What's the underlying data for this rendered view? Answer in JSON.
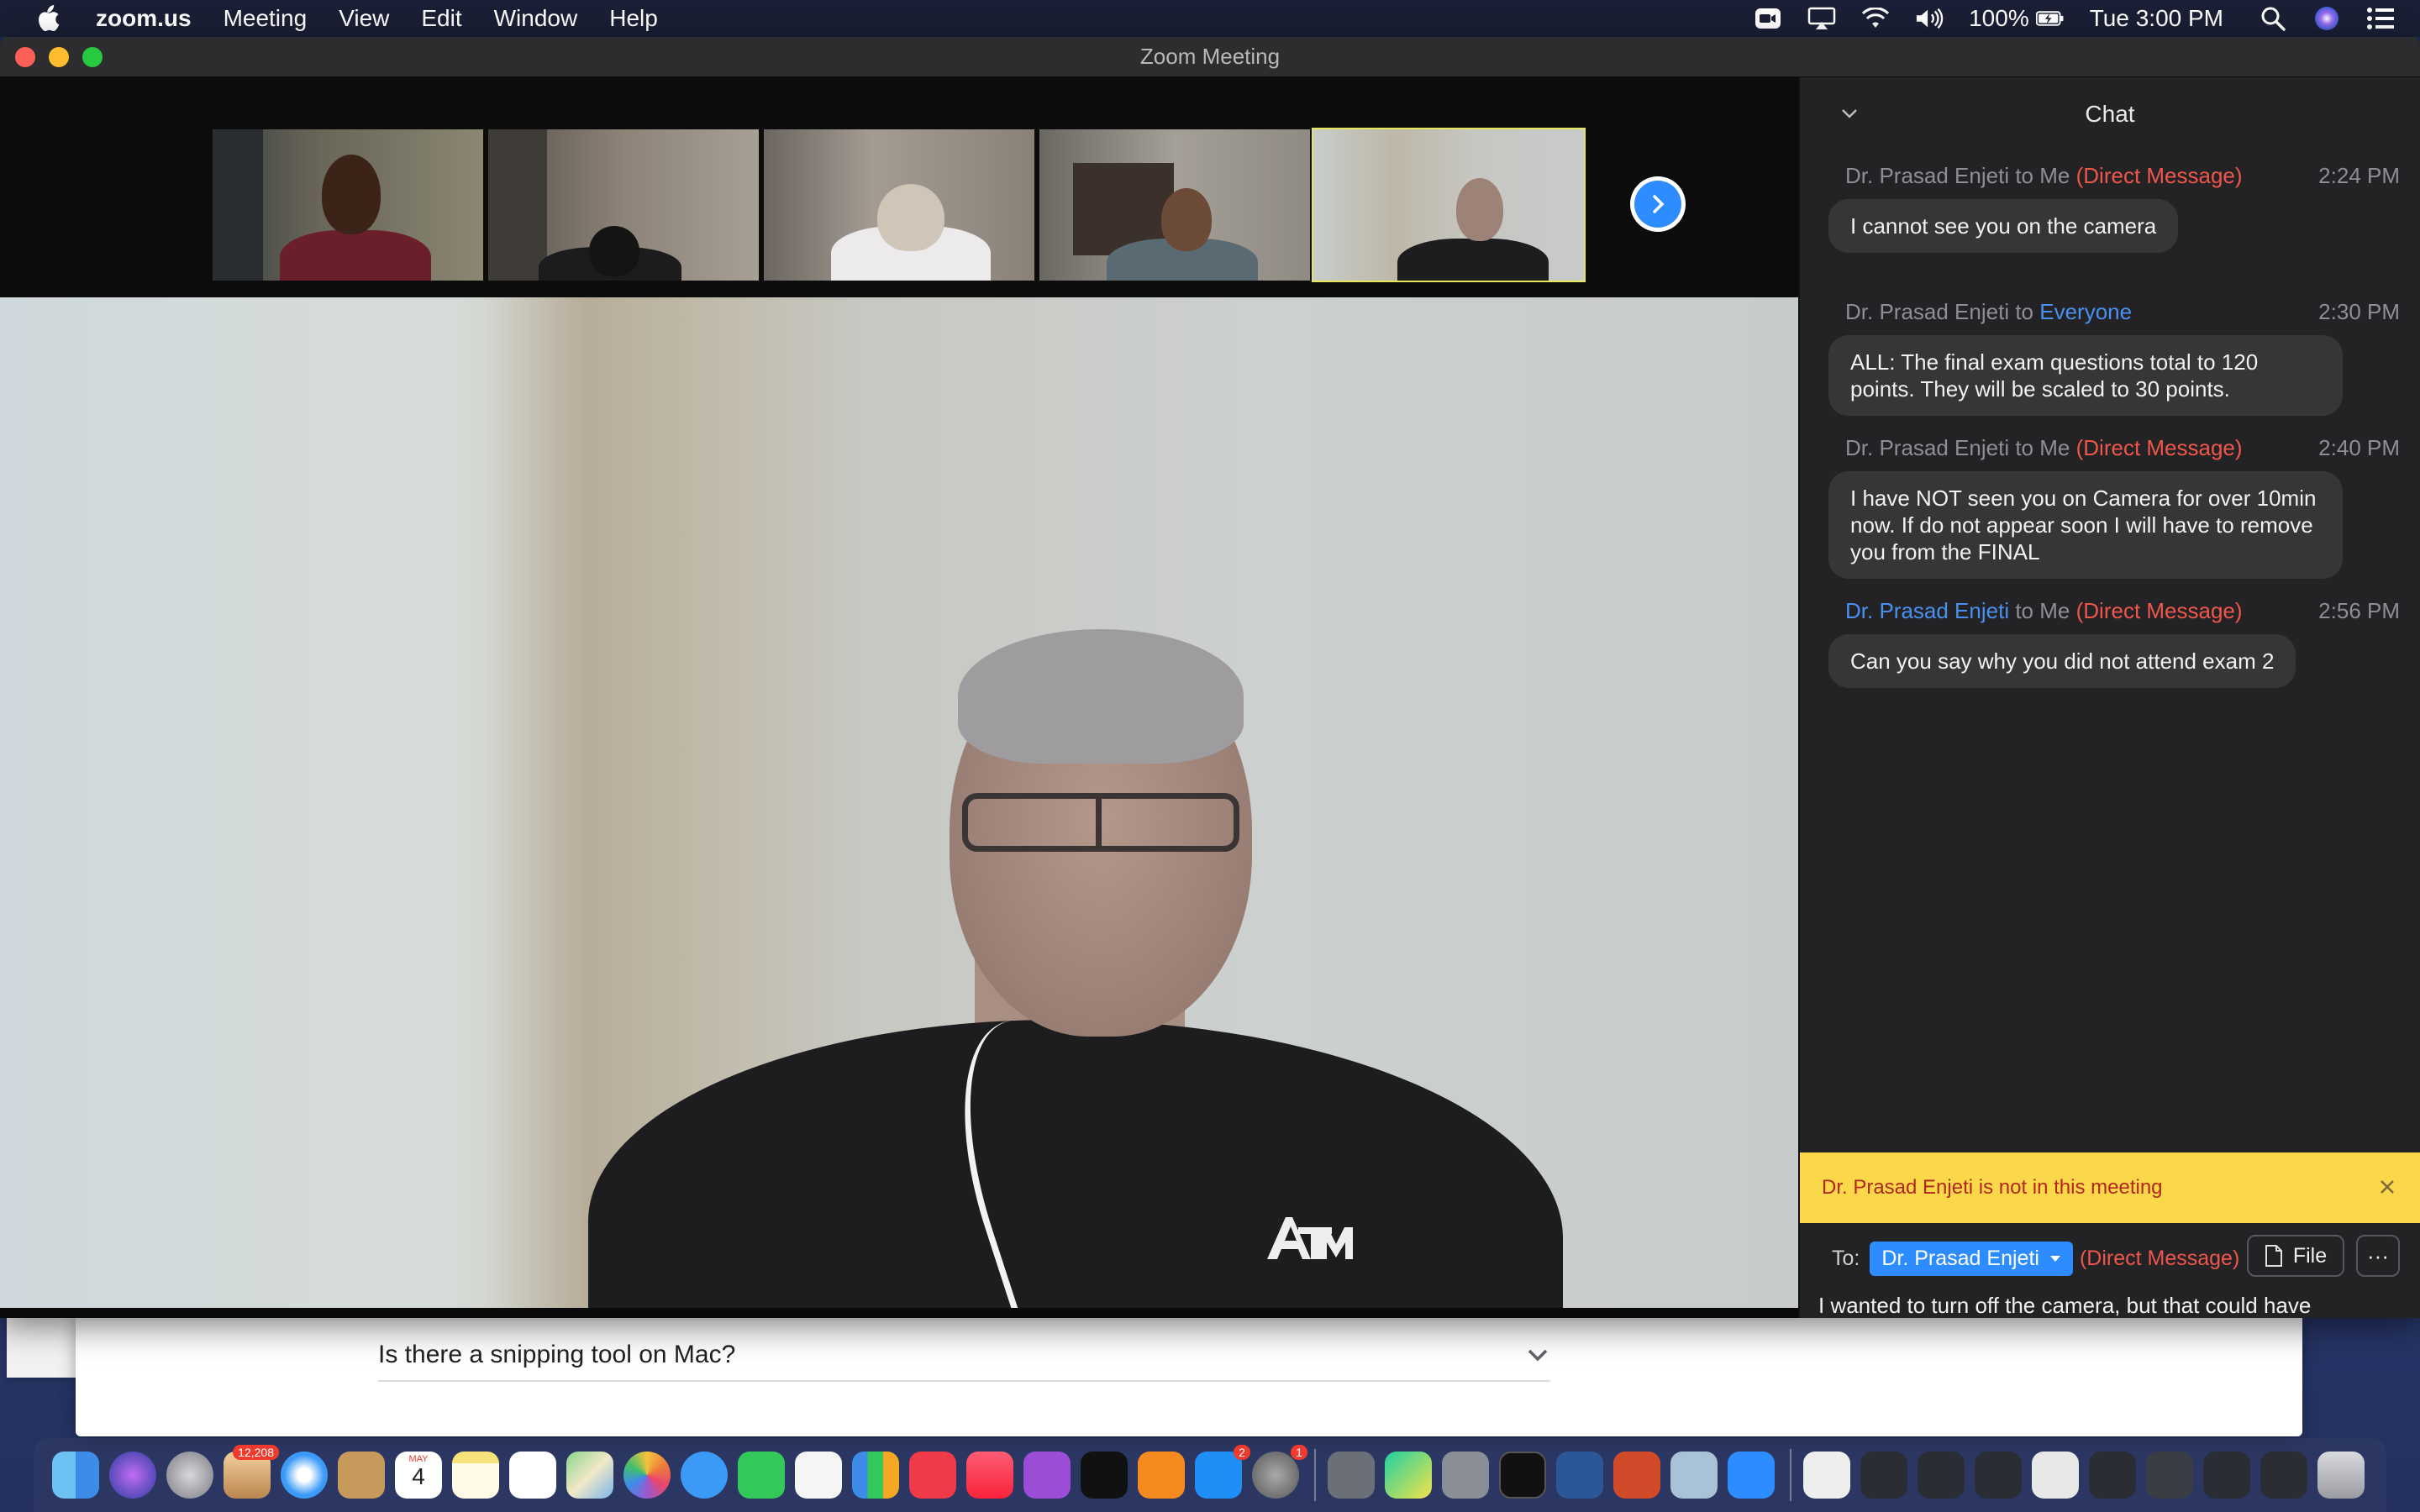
{
  "menubar": {
    "app_name": "zoom.us",
    "items": [
      "Meeting",
      "View",
      "Edit",
      "Window",
      "Help"
    ],
    "battery": "100%",
    "clock": "Tue 3:00 PM",
    "status_icons": [
      "zoom-camera-icon",
      "airplay-icon",
      "wifi-icon",
      "volume-icon",
      "battery-icon",
      "spotlight-icon",
      "siri-icon",
      "control-center-icon"
    ]
  },
  "browser": {
    "faq_question": "Is there a snipping tool on Mac?"
  },
  "zoom": {
    "window_title": "Zoom Meeting",
    "gallery": {
      "thumbnails": 5,
      "active_index": 4
    }
  },
  "chat": {
    "title": "Chat",
    "messages": [
      {
        "from": "Dr. Prasad Enjeti",
        "to_word": "to",
        "to": "Me",
        "tag": "(Direct Message)",
        "time": "2:24 PM",
        "text": "I cannot see you on the camera"
      },
      {
        "from": "Dr. Prasad Enjeti",
        "to_word": "to",
        "to": "Everyone",
        "tag": "",
        "time": "2:30 PM",
        "text": "ALL: The final exam questions total to 120 points. They will be scaled to 30 points."
      },
      {
        "from": "Dr. Prasad Enjeti",
        "to_word": "to",
        "to": "Me",
        "tag": "(Direct Message)",
        "time": "2:40 PM",
        "text": "I have NOT seen you on Camera for over 10min now. If do not appear soon I will have to remove you from the FINAL"
      },
      {
        "from": "Dr. Prasad Enjeti",
        "to_word": "to",
        "to": "Me",
        "tag": "(Direct Message)",
        "time": "2:56 PM",
        "text": "Can you say why you did not attend exam 2"
      }
    ],
    "notice": "Dr. Prasad Enjeti is not in this meeting",
    "compose": {
      "to_label": "To:",
      "recipient": "Dr. Prasad Enjeti",
      "dm_tag": "(Direct Message)",
      "file_label": "File",
      "more_label": "···",
      "draft": "I wanted to turn off the camera, but that could have appeared suspicious"
    }
  },
  "dock": {
    "badges": {
      "mail": "12,208",
      "calendar_day": "4",
      "calendar_month": "MAY",
      "app_store": "2",
      "system_prefs": "1"
    }
  }
}
